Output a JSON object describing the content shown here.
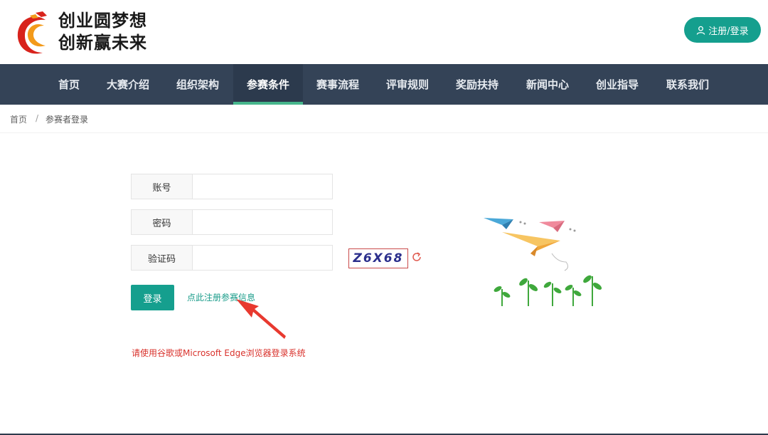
{
  "header": {
    "slogan_line1": "创业圆梦想",
    "slogan_line2": "创新赢未来",
    "register_login_label": "注册/登录",
    "register_icon": "user-icon"
  },
  "nav": {
    "items": [
      {
        "label": "首页"
      },
      {
        "label": "大赛介绍"
      },
      {
        "label": "组织架构"
      },
      {
        "label": "参赛条件"
      },
      {
        "label": "赛事流程"
      },
      {
        "label": "评审规则"
      },
      {
        "label": "奖励扶持"
      },
      {
        "label": "新闻中心"
      },
      {
        "label": "创业指导"
      },
      {
        "label": "联系我们"
      }
    ],
    "active_label": "参赛条件"
  },
  "breadcrumb": {
    "home": "首页",
    "separator": "/",
    "current": "参赛者登录"
  },
  "form": {
    "account_label": "账号",
    "account_value": "",
    "password_label": "密码",
    "password_value": "",
    "captcha_label": "验证码",
    "captcha_value": "",
    "captcha_text": "Z6X68",
    "login_label": "登录",
    "register_link": "点此注册参赛信息"
  },
  "notice": "请使用谷歌或Microsoft Edge浏览器登录系统",
  "colors": {
    "primary": "#159f8e",
    "nav_bg": "#344357",
    "nav_active_underline": "#46b68c",
    "notice": "#d9322c",
    "arrow": "#e8392f"
  }
}
